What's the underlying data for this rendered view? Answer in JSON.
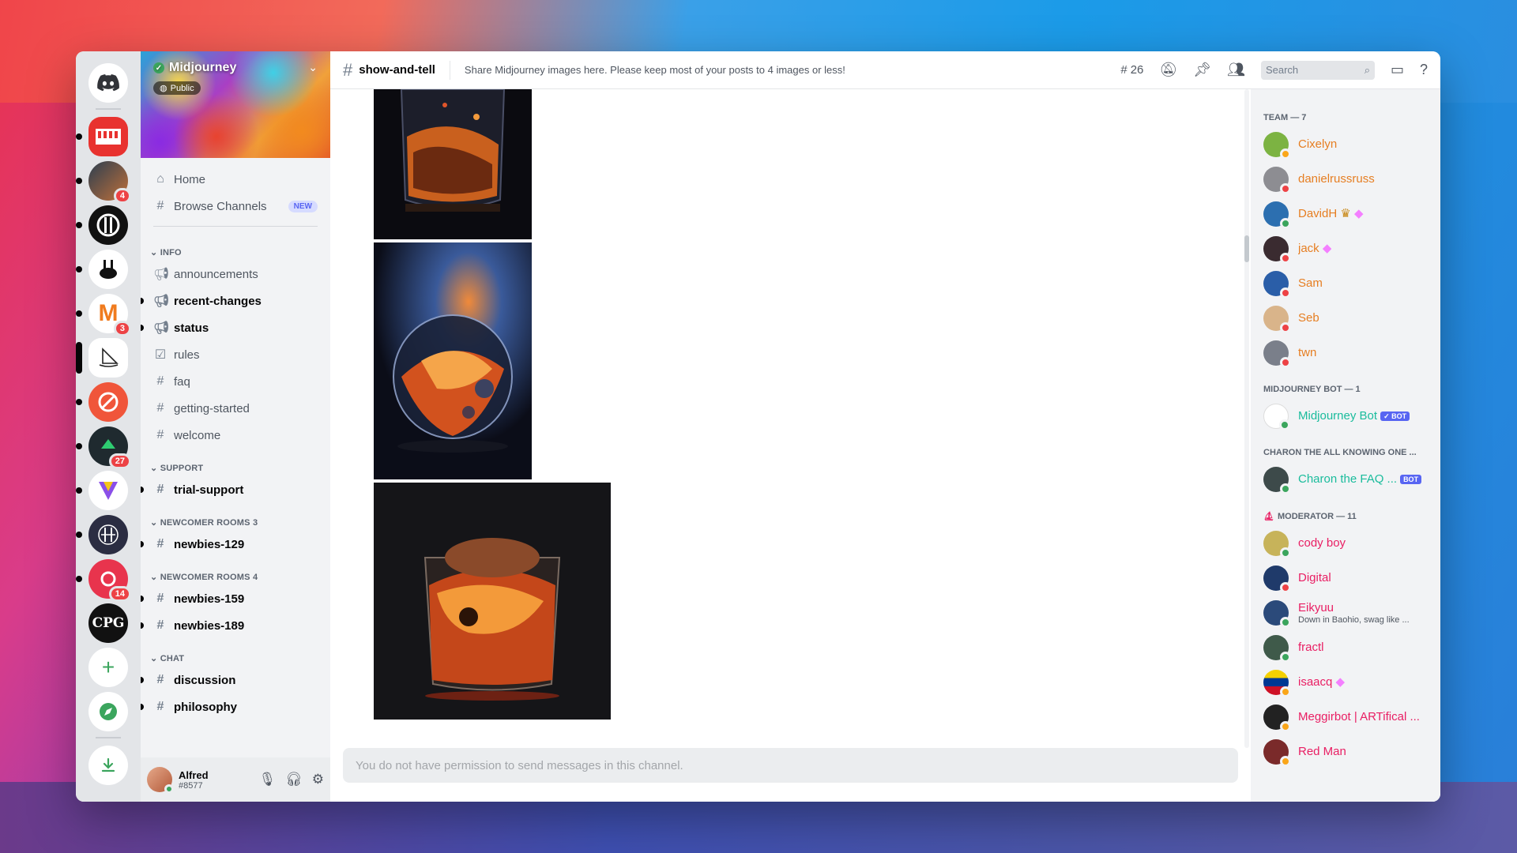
{
  "server": {
    "name": "Midjourney",
    "public_label": "Public"
  },
  "rail": {
    "badges": [
      "4",
      "3",
      "27",
      "14"
    ]
  },
  "nav": {
    "home": "Home",
    "browse": "Browse Channels",
    "new_badge": "NEW",
    "categories": {
      "info": "INFO",
      "support": "SUPPORT",
      "newcomer3": "NEWCOMER ROOMS 3",
      "newcomer4": "NEWCOMER ROOMS 4",
      "chat": "CHAT"
    },
    "channels": {
      "announcements": "announcements",
      "recent_changes": "recent-changes",
      "status": "status",
      "rules": "rules",
      "faq": "faq",
      "getting_started": "getting-started",
      "welcome": "welcome",
      "trial_support": "trial-support",
      "newbies129": "newbies-129",
      "newbies159": "newbies-159",
      "newbies189": "newbies-189",
      "discussion": "discussion",
      "philosophy": "philosophy"
    }
  },
  "user": {
    "name": "Alfred",
    "tag": "#8577"
  },
  "header": {
    "channel": "show-and-tell",
    "topic": "Share Midjourney images here. Please keep most of your posts to 4 images or less!",
    "thread_count": "26",
    "search_placeholder": "Search"
  },
  "composer": {
    "placeholder": "You do not have permission to send messages in this channel."
  },
  "members": {
    "groups": {
      "team": "TEAM — 7",
      "bot": "MIDJOURNEY BOT — 1",
      "charon": "CHARON THE ALL KNOWING ONE ...",
      "moderator": "MODERATOR — 11"
    },
    "team": [
      "Cixelyn",
      "danielrussruss",
      "DavidH",
      "jack",
      "Sam",
      "Seb",
      "twn"
    ],
    "bot_name": "Midjourney Bot",
    "bot_tag": "✓ BOT",
    "charon_name": "Charon the FAQ ...",
    "charon_tag": "BOT",
    "moderators": [
      "cody boy",
      "Digital",
      "Eikyuu",
      "fractl",
      "isaacq",
      "Meggirbot | ARTifical ...",
      "Red Man"
    ],
    "eikyuu_status": "Down in Baohio, swag like ..."
  },
  "colors": {
    "team": "#e67e22",
    "bot": "#1abc9c",
    "moderator": "#e91e63",
    "brand": "#5865f2"
  }
}
